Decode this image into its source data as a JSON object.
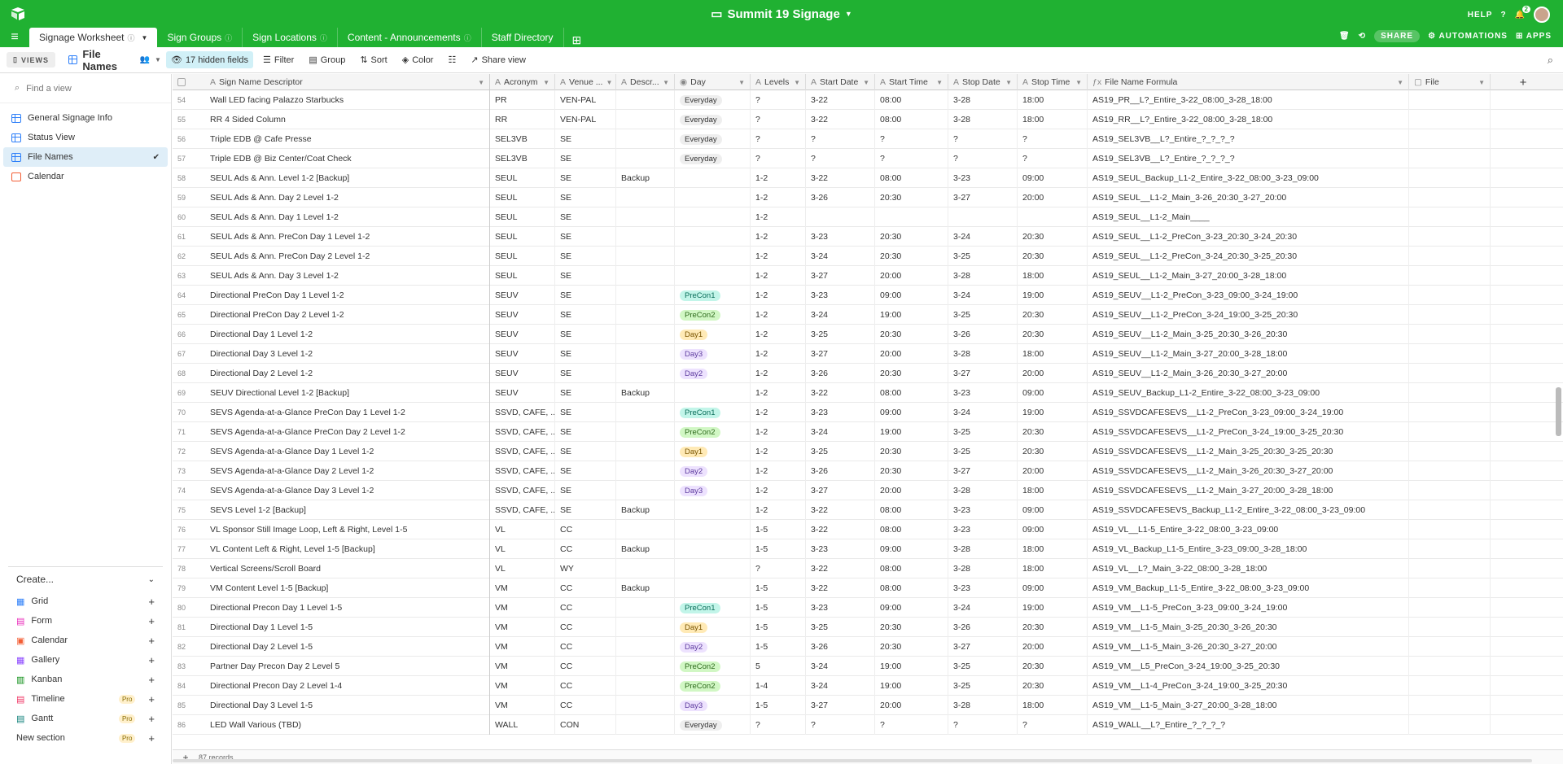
{
  "header": {
    "title": "Summit 19 Signage",
    "help": "HELP",
    "notif_count": "2"
  },
  "tabs": [
    {
      "label": "Signage Worksheet"
    },
    {
      "label": "Sign Groups"
    },
    {
      "label": "Sign Locations"
    },
    {
      "label": "Content - Announcements"
    },
    {
      "label": "Staff Directory"
    }
  ],
  "tab_actions": {
    "share": "SHARE",
    "automations": "AUTOMATIONS",
    "apps": "APPS"
  },
  "toolbar": {
    "views": "VIEWS",
    "view_name": "File Names",
    "hidden_fields": "17 hidden fields",
    "filter": "Filter",
    "group": "Group",
    "sort": "Sort",
    "color": "Color",
    "share_view": "Share view"
  },
  "sidebar": {
    "find_placeholder": "Find a view",
    "views": [
      {
        "label": "General Signage Info"
      },
      {
        "label": "Status View"
      },
      {
        "label": "File Names"
      },
      {
        "label": "Calendar"
      }
    ],
    "create": "Create...",
    "create_items": [
      {
        "label": "Grid",
        "pro": ""
      },
      {
        "label": "Form",
        "pro": ""
      },
      {
        "label": "Calendar",
        "pro": ""
      },
      {
        "label": "Gallery",
        "pro": ""
      },
      {
        "label": "Kanban",
        "pro": ""
      },
      {
        "label": "Timeline",
        "pro": "Pro"
      },
      {
        "label": "Gantt",
        "pro": "Pro"
      },
      {
        "label": "New section",
        "pro": "Pro"
      }
    ]
  },
  "columns": [
    "Sign Name Descriptor",
    "Acronym",
    "Venue ...",
    "Descr...",
    "Day",
    "Levels",
    "Start Date",
    "Start Time",
    "Stop Date",
    "Stop Time",
    "File Name Formula",
    "File"
  ],
  "day_colors": {
    "Everyday": {
      "bg": "#eeeeee",
      "fg": "#333333"
    },
    "PreCon1": {
      "bg": "#c2f5e9",
      "fg": "#0b6e5a"
    },
    "PreCon2": {
      "bg": "#d1f7c4",
      "fg": "#2f6b1e"
    },
    "Day1": {
      "bg": "#ffeab6",
      "fg": "#7a5500"
    },
    "Day2": {
      "bg": "#ede2fe",
      "fg": "#5c3a9e"
    },
    "Day3": {
      "bg": "#ede2fe",
      "fg": "#5c3a9e"
    }
  },
  "rows": [
    [
      "54",
      "Wall LED facing Palazzo Starbucks",
      "PR",
      "VEN-PAL",
      "",
      "Everyday",
      "?",
      "3-22",
      "08:00",
      "3-28",
      "18:00",
      "AS19_PR__L?_Entire_3-22_08:00_3-28_18:00"
    ],
    [
      "55",
      "RR 4 Sided Column",
      "RR",
      "VEN-PAL",
      "",
      "Everyday",
      "?",
      "3-22",
      "08:00",
      "3-28",
      "18:00",
      "AS19_RR__L?_Entire_3-22_08:00_3-28_18:00"
    ],
    [
      "56",
      "Triple EDB @ Cafe Presse",
      "SEL3VB",
      "SE",
      "",
      "Everyday",
      "?",
      "?",
      "?",
      "?",
      "?",
      "AS19_SEL3VB__L?_Entire_?_?_?_?"
    ],
    [
      "57",
      "Triple EDB @ Biz Center/Coat Check",
      "SEL3VB",
      "SE",
      "",
      "Everyday",
      "?",
      "?",
      "?",
      "?",
      "?",
      "AS19_SEL3VB__L?_Entire_?_?_?_?"
    ],
    [
      "58",
      "SEUL Ads & Ann. Level 1-2 [Backup]",
      "SEUL",
      "SE",
      "Backup",
      "",
      "1-2",
      "3-22",
      "08:00",
      "3-23",
      "09:00",
      "AS19_SEUL_Backup_L1-2_Entire_3-22_08:00_3-23_09:00"
    ],
    [
      "59",
      "SEUL Ads & Ann. Day 2 Level 1-2",
      "SEUL",
      "SE",
      "",
      "",
      "1-2",
      "3-26",
      "20:30",
      "3-27",
      "20:00",
      "AS19_SEUL__L1-2_Main_3-26_20:30_3-27_20:00"
    ],
    [
      "60",
      "SEUL Ads & Ann. Day 1 Level 1-2",
      "SEUL",
      "SE",
      "",
      "",
      "1-2",
      "",
      "",
      "",
      "",
      "AS19_SEUL__L1-2_Main____"
    ],
    [
      "61",
      "SEUL Ads & Ann. PreCon Day 1 Level 1-2",
      "SEUL",
      "SE",
      "",
      "",
      "1-2",
      "3-23",
      "20:30",
      "3-24",
      "20:30",
      "AS19_SEUL__L1-2_PreCon_3-23_20:30_3-24_20:30"
    ],
    [
      "62",
      "SEUL Ads & Ann. PreCon Day 2 Level 1-2",
      "SEUL",
      "SE",
      "",
      "",
      "1-2",
      "3-24",
      "20:30",
      "3-25",
      "20:30",
      "AS19_SEUL__L1-2_PreCon_3-24_20:30_3-25_20:30"
    ],
    [
      "63",
      "SEUL Ads & Ann. Day 3 Level 1-2",
      "SEUL",
      "SE",
      "",
      "",
      "1-2",
      "3-27",
      "20:00",
      "3-28",
      "18:00",
      "AS19_SEUL__L1-2_Main_3-27_20:00_3-28_18:00"
    ],
    [
      "64",
      "Directional PreCon Day 1 Level 1-2",
      "SEUV",
      "SE",
      "",
      "PreCon1",
      "1-2",
      "3-23",
      "09:00",
      "3-24",
      "19:00",
      "AS19_SEUV__L1-2_PreCon_3-23_09:00_3-24_19:00"
    ],
    [
      "65",
      "Directional PreCon Day 2 Level 1-2",
      "SEUV",
      "SE",
      "",
      "PreCon2",
      "1-2",
      "3-24",
      "19:00",
      "3-25",
      "20:30",
      "AS19_SEUV__L1-2_PreCon_3-24_19:00_3-25_20:30"
    ],
    [
      "66",
      "Directional Day 1 Level 1-2",
      "SEUV",
      "SE",
      "",
      "Day1",
      "1-2",
      "3-25",
      "20:30",
      "3-26",
      "20:30",
      "AS19_SEUV__L1-2_Main_3-25_20:30_3-26_20:30"
    ],
    [
      "67",
      "Directional Day 3 Level 1-2",
      "SEUV",
      "SE",
      "",
      "Day3",
      "1-2",
      "3-27",
      "20:00",
      "3-28",
      "18:00",
      "AS19_SEUV__L1-2_Main_3-27_20:00_3-28_18:00"
    ],
    [
      "68",
      "Directional Day 2 Level 1-2",
      "SEUV",
      "SE",
      "",
      "Day2",
      "1-2",
      "3-26",
      "20:30",
      "3-27",
      "20:00",
      "AS19_SEUV__L1-2_Main_3-26_20:30_3-27_20:00"
    ],
    [
      "69",
      "SEUV Directional Level 1-2 [Backup]",
      "SEUV",
      "SE",
      "Backup",
      "",
      "1-2",
      "3-22",
      "08:00",
      "3-23",
      "09:00",
      "AS19_SEUV_Backup_L1-2_Entire_3-22_08:00_3-23_09:00"
    ],
    [
      "70",
      "SEVS Agenda-at-a-Glance PreCon Day 1 Level 1-2",
      "SSVD, CAFE, ...",
      "SE",
      "",
      "PreCon1",
      "1-2",
      "3-23",
      "09:00",
      "3-24",
      "19:00",
      "AS19_SSVDCAFESEVS__L1-2_PreCon_3-23_09:00_3-24_19:00"
    ],
    [
      "71",
      "SEVS Agenda-at-a-Glance PreCon Day 2 Level 1-2",
      "SSVD, CAFE, ...",
      "SE",
      "",
      "PreCon2",
      "1-2",
      "3-24",
      "19:00",
      "3-25",
      "20:30",
      "AS19_SSVDCAFESEVS__L1-2_PreCon_3-24_19:00_3-25_20:30"
    ],
    [
      "72",
      "SEVS Agenda-at-a-Glance Day 1 Level 1-2",
      "SSVD, CAFE, ...",
      "SE",
      "",
      "Day1",
      "1-2",
      "3-25",
      "20:30",
      "3-25",
      "20:30",
      "AS19_SSVDCAFESEVS__L1-2_Main_3-25_20:30_3-25_20:30"
    ],
    [
      "73",
      "SEVS Agenda-at-a-Glance Day 2 Level 1-2",
      "SSVD, CAFE, ...",
      "SE",
      "",
      "Day2",
      "1-2",
      "3-26",
      "20:30",
      "3-27",
      "20:00",
      "AS19_SSVDCAFESEVS__L1-2_Main_3-26_20:30_3-27_20:00"
    ],
    [
      "74",
      "SEVS Agenda-at-a-Glance Day 3 Level 1-2",
      "SSVD, CAFE, ...",
      "SE",
      "",
      "Day3",
      "1-2",
      "3-27",
      "20:00",
      "3-28",
      "18:00",
      "AS19_SSVDCAFESEVS__L1-2_Main_3-27_20:00_3-28_18:00"
    ],
    [
      "75",
      "SEVS Level 1-2 [Backup]",
      "SSVD, CAFE, ...",
      "SE",
      "Backup",
      "",
      "1-2",
      "3-22",
      "08:00",
      "3-23",
      "09:00",
      "AS19_SSVDCAFESEVS_Backup_L1-2_Entire_3-22_08:00_3-23_09:00"
    ],
    [
      "76",
      "VL Sponsor Still Image Loop, Left & Right, Level 1-5",
      "VL",
      "CC",
      "",
      "",
      "1-5",
      "3-22",
      "08:00",
      "3-23",
      "09:00",
      "AS19_VL__L1-5_Entire_3-22_08:00_3-23_09:00"
    ],
    [
      "77",
      "VL Content Left & Right, Level 1-5 [Backup]",
      "VL",
      "CC",
      "Backup",
      "",
      "1-5",
      "3-23",
      "09:00",
      "3-28",
      "18:00",
      "AS19_VL_Backup_L1-5_Entire_3-23_09:00_3-28_18:00"
    ],
    [
      "78",
      "Vertical Screens/Scroll Board",
      "VL",
      "WY",
      "",
      "",
      "?",
      "3-22",
      "08:00",
      "3-28",
      "18:00",
      "AS19_VL__L?_Main_3-22_08:00_3-28_18:00"
    ],
    [
      "79",
      "VM Content Level 1-5 [Backup]",
      "VM",
      "CC",
      "Backup",
      "",
      "1-5",
      "3-22",
      "08:00",
      "3-23",
      "09:00",
      "AS19_VM_Backup_L1-5_Entire_3-22_08:00_3-23_09:00"
    ],
    [
      "80",
      "Directional Precon Day 1 Level 1-5",
      "VM",
      "CC",
      "",
      "PreCon1",
      "1-5",
      "3-23",
      "09:00",
      "3-24",
      "19:00",
      "AS19_VM__L1-5_PreCon_3-23_09:00_3-24_19:00"
    ],
    [
      "81",
      "Directional Day 1 Level 1-5",
      "VM",
      "CC",
      "",
      "Day1",
      "1-5",
      "3-25",
      "20:30",
      "3-26",
      "20:30",
      "AS19_VM__L1-5_Main_3-25_20:30_3-26_20:30"
    ],
    [
      "82",
      "Directional Day 2 Level 1-5",
      "VM",
      "CC",
      "",
      "Day2",
      "1-5",
      "3-26",
      "20:30",
      "3-27",
      "20:00",
      "AS19_VM__L1-5_Main_3-26_20:30_3-27_20:00"
    ],
    [
      "83",
      "Partner Day Precon Day 2 Level 5",
      "VM",
      "CC",
      "",
      "PreCon2",
      "5",
      "3-24",
      "19:00",
      "3-25",
      "20:30",
      "AS19_VM__L5_PreCon_3-24_19:00_3-25_20:30"
    ],
    [
      "84",
      "Directional Precon Day 2 Level 1-4",
      "VM",
      "CC",
      "",
      "PreCon2",
      "1-4",
      "3-24",
      "19:00",
      "3-25",
      "20:30",
      "AS19_VM__L1-4_PreCon_3-24_19:00_3-25_20:30"
    ],
    [
      "85",
      "Directional Day 3 Level 1-5",
      "VM",
      "CC",
      "",
      "Day3",
      "1-5",
      "3-27",
      "20:00",
      "3-28",
      "18:00",
      "AS19_VM__L1-5_Main_3-27_20:00_3-28_18:00"
    ],
    [
      "86",
      "LED Wall Various (TBD)",
      "WALL",
      "CON",
      "",
      "Everyday",
      "?",
      "?",
      "?",
      "?",
      "?",
      "AS19_WALL__L?_Entire_?_?_?_?"
    ]
  ],
  "footer": {
    "records": "87 records"
  }
}
